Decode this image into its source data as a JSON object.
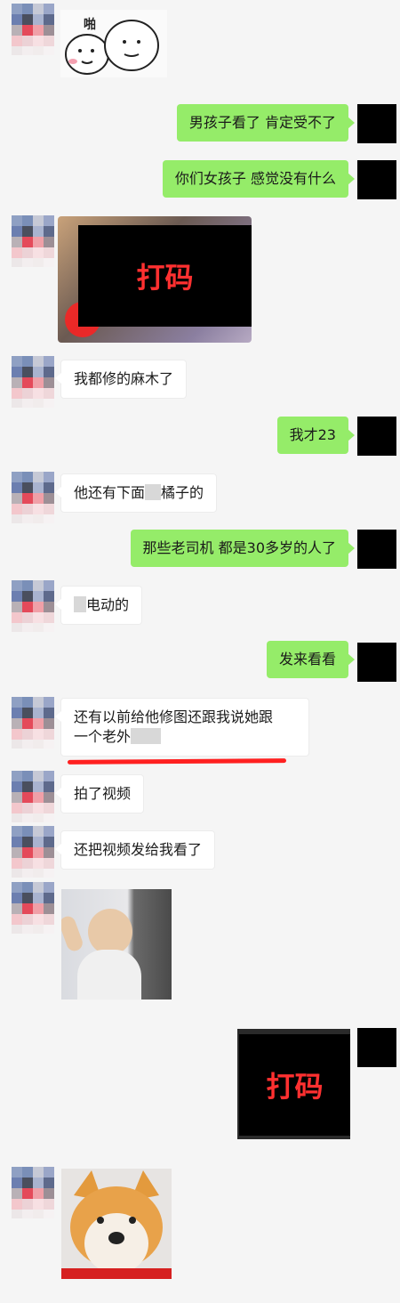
{
  "messages": {
    "m1": "男孩子看了 肯定受不了",
    "m2": "你们女孩子 感觉没有什么",
    "m3": "我都修的麻木了",
    "m4": "我才23",
    "m5a": "他还有下面",
    "m5b": "橘子的",
    "m6": "那些老司机 都是30多岁的人了",
    "m7": "电动的",
    "m8": "发来看看",
    "m9a": "还有以前给他修图还跟我说她跟",
    "m9b": "一个老外",
    "m10": "拍了视频",
    "m11": "还把视频发给我看了"
  },
  "sticker1_text": "啪",
  "mosaic_label": "打码",
  "colors": {
    "background": "#f5f5f5",
    "right_bubble": "#95ec69",
    "left_bubble": "#ffffff",
    "mosaic_text": "#ff3030",
    "underline": "#ff2020"
  }
}
